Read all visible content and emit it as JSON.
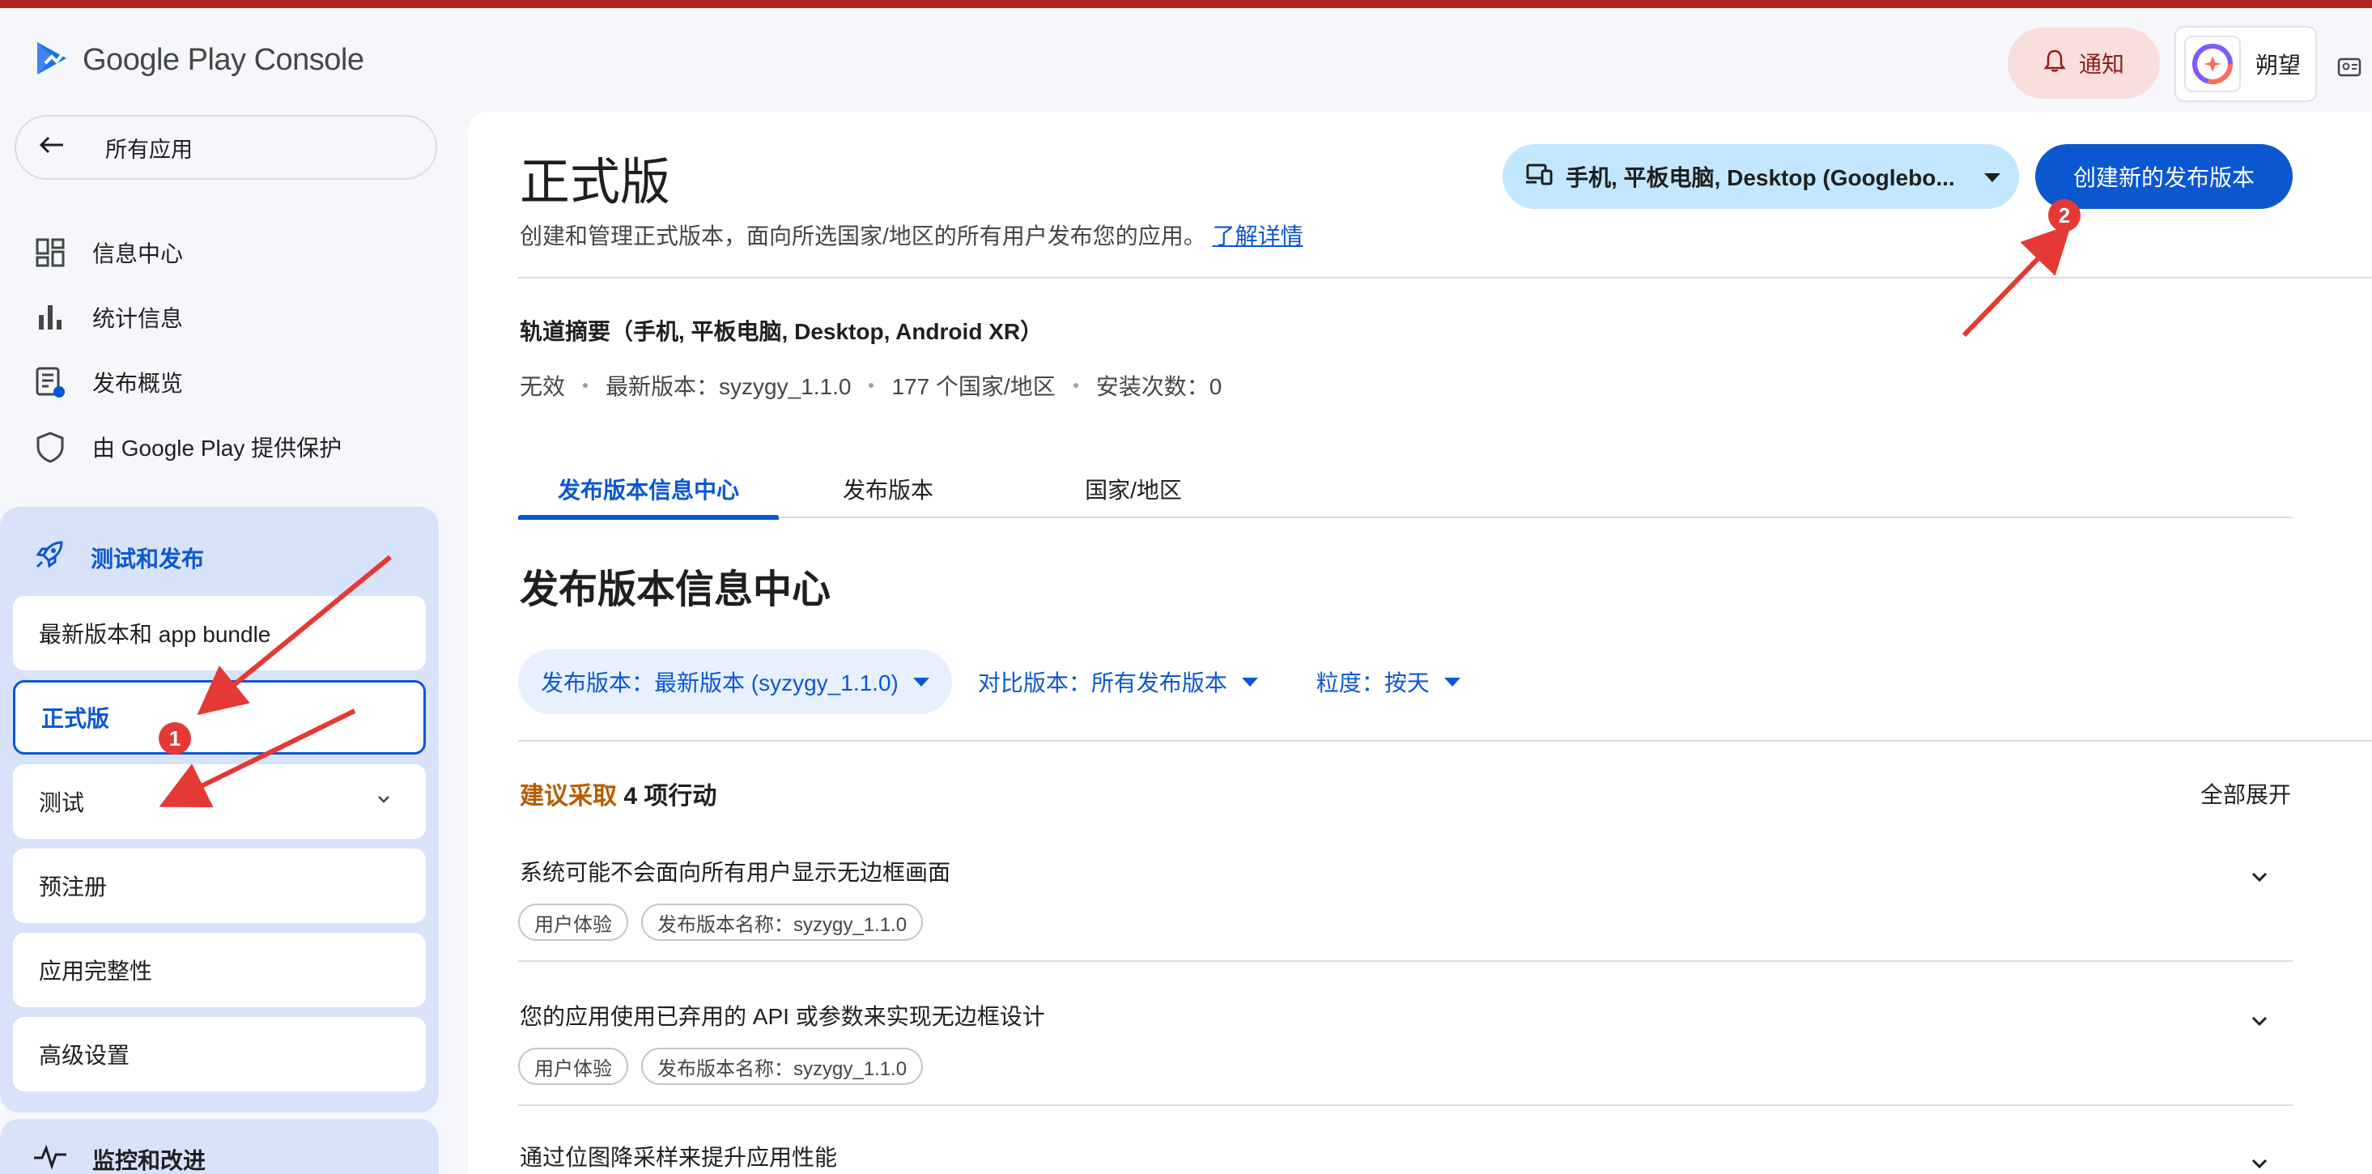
{
  "header": {
    "logo_text": "Google Play Console",
    "notification_label": "通知",
    "user_name": "朔望"
  },
  "sidebar": {
    "back_label": "所有应用",
    "nav_items": [
      {
        "label": "信息中心",
        "icon": "dashboard-icon"
      },
      {
        "label": "统计信息",
        "icon": "bar-chart-icon"
      },
      {
        "label": "发布概览",
        "icon": "release-overview-icon"
      },
      {
        "label": "由 Google Play 提供保护",
        "icon": "shield-icon"
      }
    ],
    "group_title": "测试和发布",
    "sub_items": [
      {
        "label": "最新版本和 app bundle"
      },
      {
        "label": "正式版"
      },
      {
        "label": "测试"
      },
      {
        "label": "预注册"
      },
      {
        "label": "应用完整性"
      },
      {
        "label": "高级设置"
      }
    ],
    "group2_title": "监控和改进"
  },
  "main": {
    "title": "正式版",
    "description": "创建和管理正式版本，面向所选国家/地区的所有用户发布您的应用。",
    "learn_more": "了解详情",
    "device_selector": "手机, 平板电脑, Desktop (Googlebo...",
    "create_release_button": "创建新的发布版本",
    "track_summary_title": "轨道摘要（手机, 平板电脑, Desktop, Android XR）",
    "track_stats": [
      "无效",
      "最新版本：syzygy_1.1.0",
      "177 个国家/地区",
      "安装次数：0"
    ],
    "tabs": [
      "发布版本信息中心",
      "发布版本",
      "国家/地区"
    ],
    "section_title": "发布版本信息中心",
    "filters": {
      "release": "发布版本：最新版本 (syzygy_1.1.0)",
      "compare": "对比版本：所有发布版本",
      "granularity": "粒度：按天"
    },
    "actions_prefix": "建议采取",
    "actions_count": "4 项行动",
    "expand_all": "全部展开",
    "issues": [
      {
        "title": "系统可能不会面向所有用户显示无边框画面",
        "tags": [
          "用户体验",
          "发布版本名称：syzygy_1.1.0"
        ]
      },
      {
        "title": "您的应用使用已弃用的 API 或参数来实现无边框设计",
        "tags": [
          "用户体验",
          "发布版本名称：syzygy_1.1.0"
        ]
      },
      {
        "title": "通过位图降采样来提升应用性能",
        "tags": []
      }
    ]
  },
  "annotations": {
    "badge_1": "1",
    "badge_2": "2",
    "color": "#e53935"
  },
  "colors": {
    "primary": "#0b57d0",
    "orange": "#b55d00",
    "top_bar": "#b3261e",
    "notification_bg": "#f9dedc",
    "device_chip_bg": "#c2e7ff"
  }
}
